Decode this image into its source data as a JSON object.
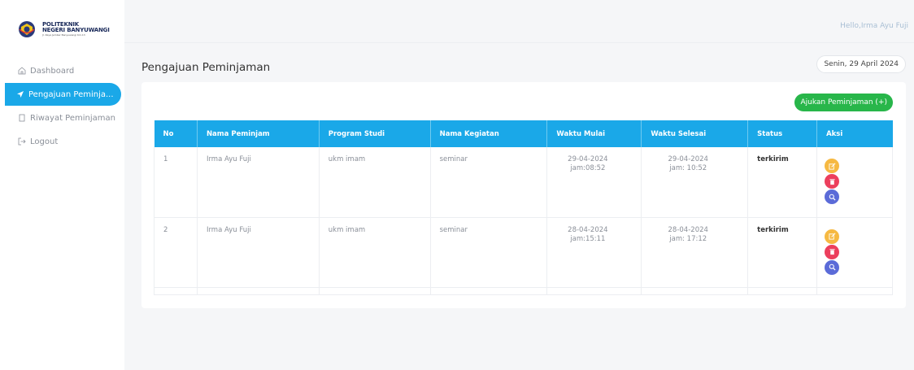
{
  "logo": {
    "line1": "POLITEKNIK",
    "line2": "NEGERI BANYUWANGI",
    "line3": "Jl. Raya Jember Banyuwangi Km.13"
  },
  "header": {
    "greeting": "Hello,Irma Ayu Fuji"
  },
  "sidebar": {
    "items": [
      {
        "label": "Dashboard",
        "icon": "home-icon",
        "active": false
      },
      {
        "label": "Pengajuan Peminja...",
        "icon": "send-icon",
        "active": true
      },
      {
        "label": "Riwayat Peminjaman",
        "icon": "document-icon",
        "active": false
      },
      {
        "label": "Logout",
        "icon": "logout-icon",
        "active": false
      }
    ]
  },
  "main": {
    "title": "Pengajuan Peminjaman",
    "date": "Senin, 29 April 2024",
    "add_button": "Ajukan Peminjaman (+)",
    "table": {
      "columns": [
        "No",
        "Nama Peminjam",
        "Program Studi",
        "Nama Kegiatan",
        "Waktu Mulai",
        "Waktu Selesai",
        "Status",
        "Aksi"
      ],
      "rows": [
        {
          "no": "1",
          "nama": "Irma Ayu Fuji",
          "prodi": "ukm imam",
          "kegiatan": "seminar",
          "mulai_tanggal": "29-04-2024",
          "mulai_jam": "jam:08:52",
          "selesai_tanggal": "29-04-2024",
          "selesai_jam": "jam: 10:52",
          "status": "terkirim"
        },
        {
          "no": "2",
          "nama": "Irma Ayu Fuji",
          "prodi": "ukm imam",
          "kegiatan": "seminar",
          "mulai_tanggal": "28-04-2024",
          "mulai_jam": "jam:15:11",
          "selesai_tanggal": "28-04-2024",
          "selesai_jam": "jam: 17:12",
          "status": "terkirim"
        }
      ]
    }
  },
  "colors": {
    "accent": "#1aa8e8",
    "success": "#28b64a",
    "edit": "#f6b942",
    "delete": "#ec3f5d",
    "view": "#5b6bd8"
  }
}
